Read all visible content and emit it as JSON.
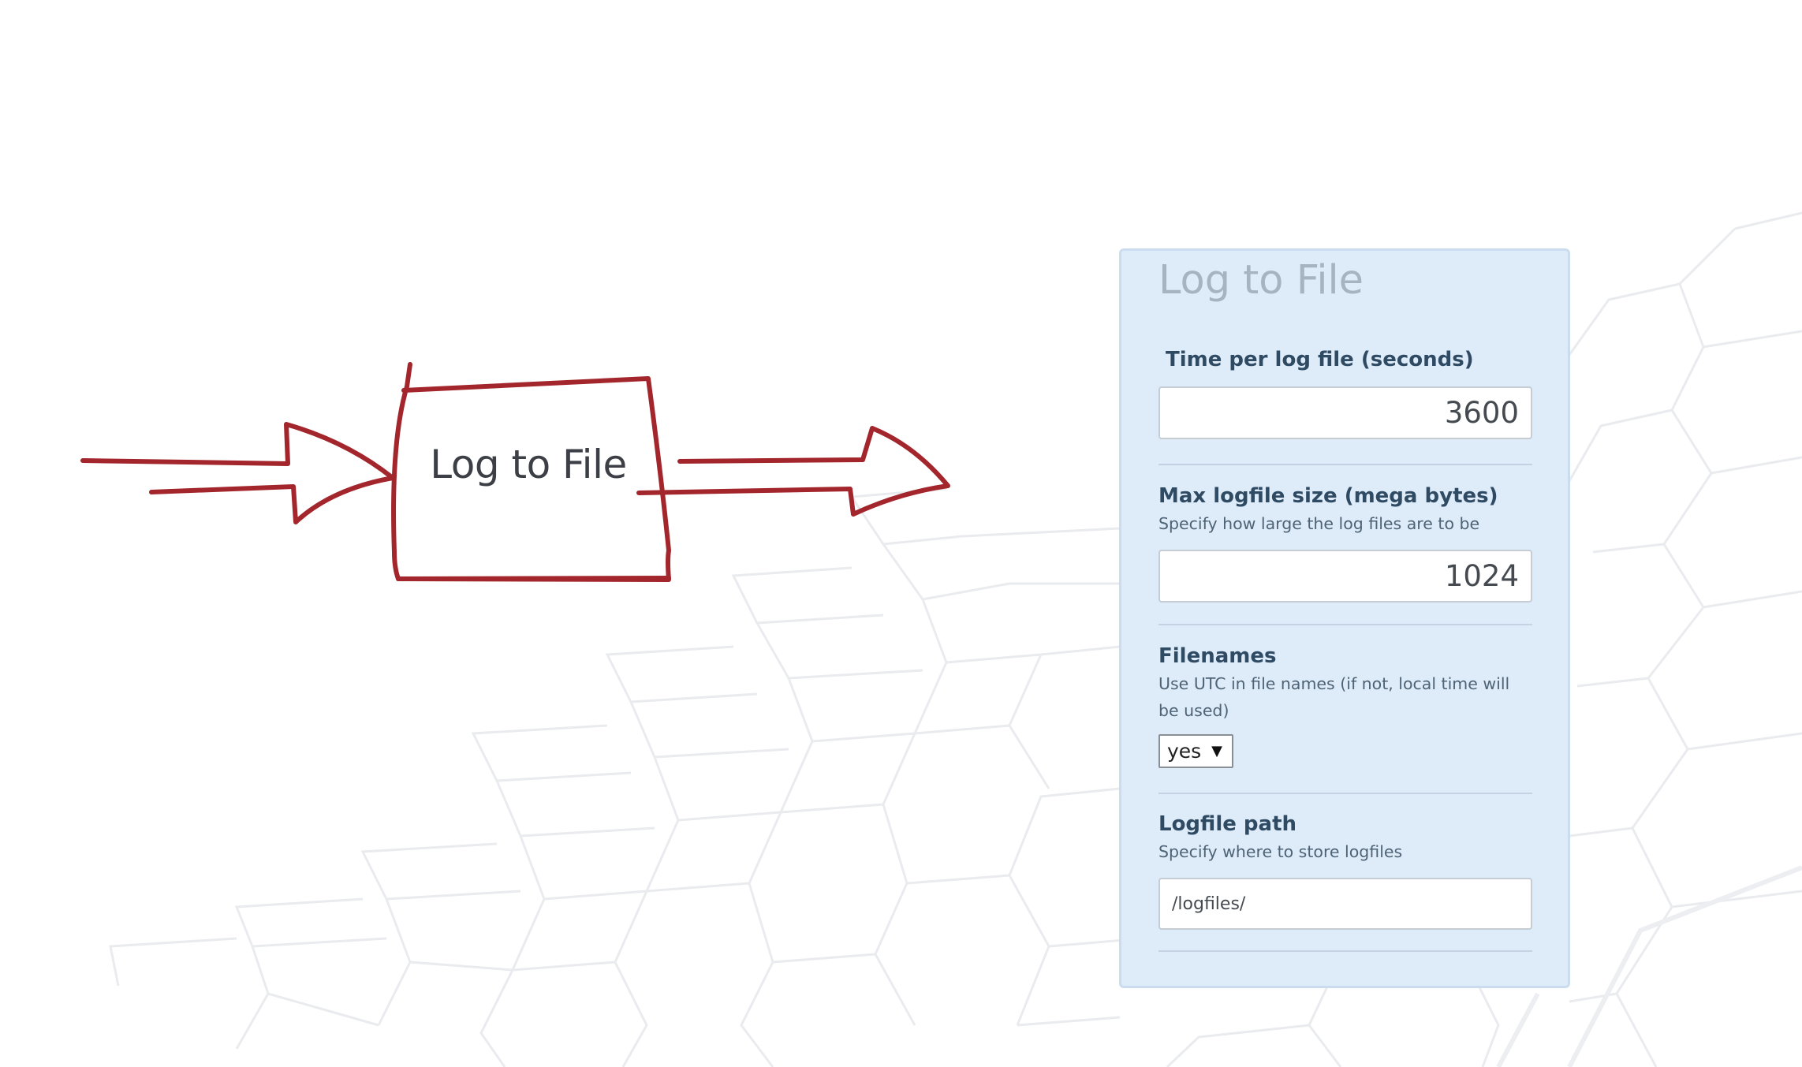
{
  "diagram": {
    "label": "Log to File",
    "stroke_color": "#a3262c"
  },
  "panel": {
    "title": "Log to File",
    "fields": [
      {
        "label": "Time per log file (seconds)",
        "value": "3600"
      },
      {
        "label": "Max logfile size (mega bytes)",
        "help": "Specify how large the log files are to be",
        "value": "1024"
      },
      {
        "label": "Filenames",
        "help": "Use UTC in file names (if not, local time will be used)",
        "selected": "yes"
      },
      {
        "label": "Logfile path",
        "help": "Specify where to store logfiles",
        "value": "/logfiles/"
      }
    ]
  },
  "colors": {
    "panel_background": "#deebf8",
    "panel_title": "#a6b4c2",
    "label_text": "#2f4a63",
    "arrow_red": "#a3262c"
  }
}
